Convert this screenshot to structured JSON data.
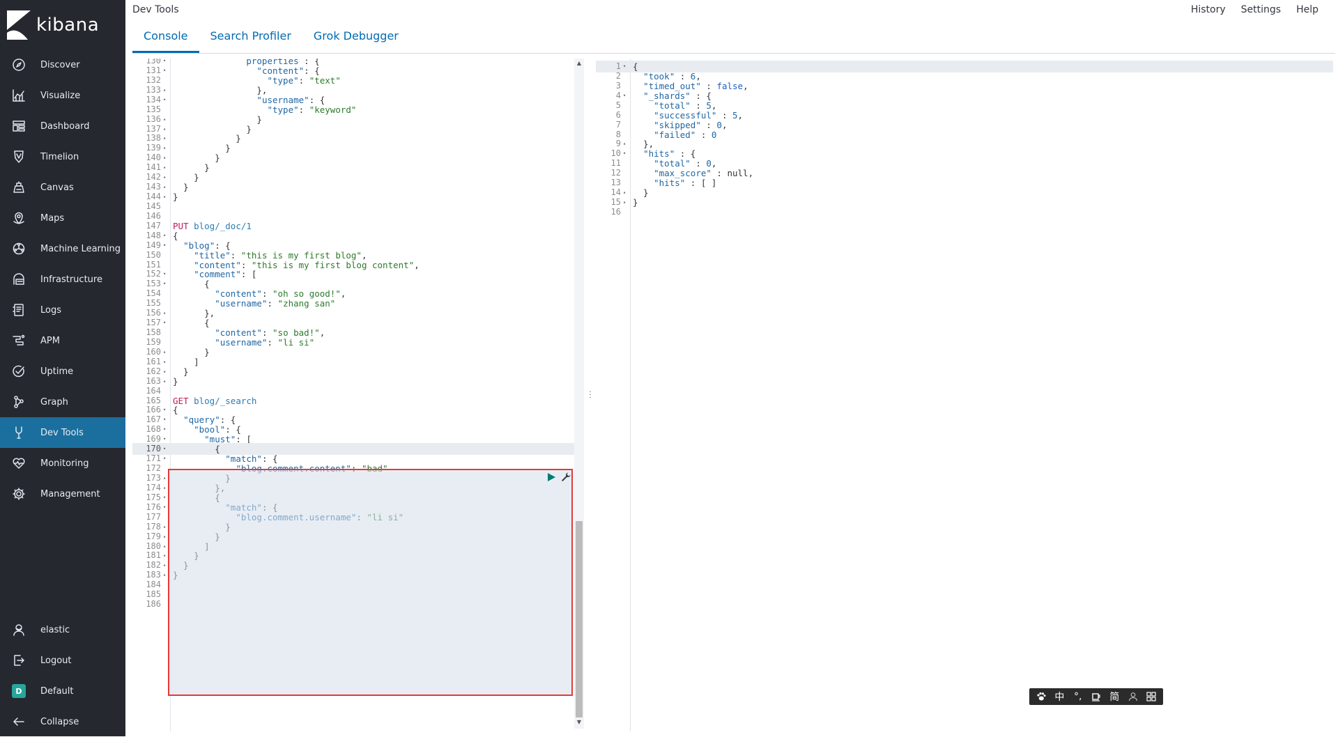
{
  "app": {
    "brand": "kibana",
    "title": "Dev Tools"
  },
  "header_links": [
    "History",
    "Settings",
    "Help"
  ],
  "tabs": [
    {
      "label": "Console",
      "active": true
    },
    {
      "label": "Search Profiler",
      "active": false
    },
    {
      "label": "Grok Debugger",
      "active": false
    }
  ],
  "sidebar": {
    "items": [
      {
        "label": "Discover",
        "icon": "compass-icon"
      },
      {
        "label": "Visualize",
        "icon": "visualize-icon"
      },
      {
        "label": "Dashboard",
        "icon": "dashboard-icon"
      },
      {
        "label": "Timelion",
        "icon": "timelion-icon"
      },
      {
        "label": "Canvas",
        "icon": "canvas-icon"
      },
      {
        "label": "Maps",
        "icon": "maps-icon"
      },
      {
        "label": "Machine Learning",
        "icon": "machine-learning-icon"
      },
      {
        "label": "Infrastructure",
        "icon": "infrastructure-icon"
      },
      {
        "label": "Logs",
        "icon": "logs-icon"
      },
      {
        "label": "APM",
        "icon": "apm-icon"
      },
      {
        "label": "Uptime",
        "icon": "uptime-icon"
      },
      {
        "label": "Graph",
        "icon": "graph-icon"
      },
      {
        "label": "Dev Tools",
        "icon": "dev-tools-icon",
        "active": true
      },
      {
        "label": "Monitoring",
        "icon": "monitoring-icon"
      },
      {
        "label": "Management",
        "icon": "gear-icon"
      }
    ],
    "bottom": [
      {
        "label": "elastic",
        "icon": "user-icon"
      },
      {
        "label": "Logout",
        "icon": "logout-icon"
      },
      {
        "label": "Default",
        "icon": "space-badge-icon",
        "badge": "D"
      },
      {
        "label": "Collapse",
        "icon": "arrow-left-icon"
      }
    ]
  },
  "colors": {
    "sidebar_bg": "#25282f",
    "active_bg": "#1b6f9e",
    "link_blue": "#006bb4",
    "selection_border": "#e53935"
  },
  "editor": {
    "current_line": "170",
    "lines": [
      {
        "n": "130",
        "fold": "▾",
        "t": [
          [
            "p",
            "              "
          ],
          [
            "k",
            "properties"
          ],
          [
            "p",
            " : {"
          ]
        ]
      },
      {
        "n": "131",
        "fold": "▾",
        "t": [
          [
            "p",
            "                "
          ],
          [
            "k",
            "\"content\""
          ],
          [
            "p",
            ": {"
          ]
        ]
      },
      {
        "n": "132",
        "fold": "",
        "t": [
          [
            "p",
            "                  "
          ],
          [
            "k",
            "\"type\""
          ],
          [
            "p",
            ": "
          ],
          [
            "s",
            "\"text\""
          ]
        ]
      },
      {
        "n": "133",
        "fold": "▴",
        "t": [
          [
            "p",
            "                },"
          ]
        ]
      },
      {
        "n": "134",
        "fold": "▾",
        "t": [
          [
            "p",
            "                "
          ],
          [
            "k",
            "\"username\""
          ],
          [
            "p",
            ": {"
          ]
        ]
      },
      {
        "n": "135",
        "fold": "",
        "t": [
          [
            "p",
            "                  "
          ],
          [
            "k",
            "\"type\""
          ],
          [
            "p",
            ": "
          ],
          [
            "s",
            "\"keyword\""
          ]
        ]
      },
      {
        "n": "136",
        "fold": "▴",
        "t": [
          [
            "p",
            "                }"
          ]
        ]
      },
      {
        "n": "137",
        "fold": "▴",
        "t": [
          [
            "p",
            "              }"
          ]
        ]
      },
      {
        "n": "138",
        "fold": "▴",
        "t": [
          [
            "p",
            "            }"
          ]
        ]
      },
      {
        "n": "139",
        "fold": "▴",
        "t": [
          [
            "p",
            "          }"
          ]
        ]
      },
      {
        "n": "140",
        "fold": "▴",
        "t": [
          [
            "p",
            "        }"
          ]
        ]
      },
      {
        "n": "141",
        "fold": "▴",
        "t": [
          [
            "p",
            "      }"
          ]
        ]
      },
      {
        "n": "142",
        "fold": "▴",
        "t": [
          [
            "p",
            "    }"
          ]
        ]
      },
      {
        "n": "143",
        "fold": "▴",
        "t": [
          [
            "p",
            "  }"
          ]
        ]
      },
      {
        "n": "144",
        "fold": "▴",
        "t": [
          [
            "p",
            "}"
          ]
        ]
      },
      {
        "n": "145",
        "fold": "",
        "t": []
      },
      {
        "n": "146",
        "fold": "",
        "t": []
      },
      {
        "n": "147",
        "fold": "",
        "t": [
          [
            "m",
            "PUT"
          ],
          [
            "p",
            " "
          ],
          [
            "u",
            "blog/_doc/1"
          ]
        ]
      },
      {
        "n": "148",
        "fold": "▾",
        "t": [
          [
            "p",
            "{"
          ]
        ]
      },
      {
        "n": "149",
        "fold": "▾",
        "t": [
          [
            "p",
            "  "
          ],
          [
            "k",
            "\"blog\""
          ],
          [
            "p",
            ": {"
          ]
        ]
      },
      {
        "n": "150",
        "fold": "",
        "t": [
          [
            "p",
            "    "
          ],
          [
            "k",
            "\"title\""
          ],
          [
            "p",
            ": "
          ],
          [
            "s",
            "\"this is my first blog\""
          ],
          [
            "p",
            ","
          ]
        ]
      },
      {
        "n": "151",
        "fold": "",
        "t": [
          [
            "p",
            "    "
          ],
          [
            "k",
            "\"content\""
          ],
          [
            "p",
            ": "
          ],
          [
            "s",
            "\"this is my first blog content\""
          ],
          [
            "p",
            ","
          ]
        ]
      },
      {
        "n": "152",
        "fold": "▾",
        "t": [
          [
            "p",
            "    "
          ],
          [
            "k",
            "\"comment\""
          ],
          [
            "p",
            ": ["
          ]
        ]
      },
      {
        "n": "153",
        "fold": "▾",
        "t": [
          [
            "p",
            "      {"
          ]
        ]
      },
      {
        "n": "154",
        "fold": "",
        "t": [
          [
            "p",
            "        "
          ],
          [
            "k",
            "\"content\""
          ],
          [
            "p",
            ": "
          ],
          [
            "s",
            "\"oh so good!\""
          ],
          [
            "p",
            ","
          ]
        ]
      },
      {
        "n": "155",
        "fold": "",
        "t": [
          [
            "p",
            "        "
          ],
          [
            "k",
            "\"username\""
          ],
          [
            "p",
            ": "
          ],
          [
            "s",
            "\"zhang san\""
          ]
        ]
      },
      {
        "n": "156",
        "fold": "▴",
        "t": [
          [
            "p",
            "      },"
          ]
        ]
      },
      {
        "n": "157",
        "fold": "▾",
        "t": [
          [
            "p",
            "      {"
          ]
        ]
      },
      {
        "n": "158",
        "fold": "",
        "t": [
          [
            "p",
            "        "
          ],
          [
            "k",
            "\"content\""
          ],
          [
            "p",
            ": "
          ],
          [
            "s",
            "\"so bad!\""
          ],
          [
            "p",
            ","
          ]
        ]
      },
      {
        "n": "159",
        "fold": "",
        "t": [
          [
            "p",
            "        "
          ],
          [
            "k",
            "\"username\""
          ],
          [
            "p",
            ": "
          ],
          [
            "s",
            "\"li si\""
          ]
        ]
      },
      {
        "n": "160",
        "fold": "▴",
        "t": [
          [
            "p",
            "      }"
          ]
        ]
      },
      {
        "n": "161",
        "fold": "▴",
        "t": [
          [
            "p",
            "    ]"
          ]
        ]
      },
      {
        "n": "162",
        "fold": "▴",
        "t": [
          [
            "p",
            "  }"
          ]
        ]
      },
      {
        "n": "163",
        "fold": "▴",
        "t": [
          [
            "p",
            "}"
          ]
        ]
      },
      {
        "n": "164",
        "fold": "",
        "t": []
      },
      {
        "n": "165",
        "fold": "",
        "t": [
          [
            "m",
            "GET"
          ],
          [
            "p",
            " "
          ],
          [
            "u",
            "blog/_search"
          ]
        ]
      },
      {
        "n": "166",
        "fold": "▾",
        "t": [
          [
            "p",
            "{"
          ]
        ]
      },
      {
        "n": "167",
        "fold": "▾",
        "t": [
          [
            "p",
            "  "
          ],
          [
            "k",
            "\"query\""
          ],
          [
            "p",
            ": {"
          ]
        ]
      },
      {
        "n": "168",
        "fold": "▾",
        "t": [
          [
            "p",
            "    "
          ],
          [
            "k",
            "\"bool\""
          ],
          [
            "p",
            ": {"
          ]
        ]
      },
      {
        "n": "169",
        "fold": "▾",
        "t": [
          [
            "p",
            "      "
          ],
          [
            "k",
            "\"must\""
          ],
          [
            "p",
            ": ["
          ]
        ]
      },
      {
        "n": "170",
        "fold": "▾",
        "t": [
          [
            "p",
            "        {"
          ]
        ]
      },
      {
        "n": "171",
        "fold": "▾",
        "t": [
          [
            "p",
            "          "
          ],
          [
            "k",
            "\"match\""
          ],
          [
            "p",
            ": {"
          ]
        ]
      },
      {
        "n": "172",
        "fold": "",
        "t": [
          [
            "p",
            "            "
          ],
          [
            "k",
            "\"blog.comment.content\""
          ],
          [
            "p",
            ": "
          ],
          [
            "s",
            "\"bad\""
          ]
        ]
      },
      {
        "n": "173",
        "fold": "▴",
        "t": [
          [
            "p",
            "          }"
          ]
        ]
      },
      {
        "n": "174",
        "fold": "▴",
        "t": [
          [
            "p",
            "        },"
          ]
        ]
      },
      {
        "n": "175",
        "fold": "▾",
        "t": [
          [
            "p",
            "        {"
          ]
        ]
      },
      {
        "n": "176",
        "fold": "▾",
        "t": [
          [
            "p",
            "          "
          ],
          [
            "k",
            "\"match\""
          ],
          [
            "p",
            ": {"
          ]
        ]
      },
      {
        "n": "177",
        "fold": "",
        "t": [
          [
            "p",
            "            "
          ],
          [
            "k",
            "\"blog.comment.username\""
          ],
          [
            "p",
            ": "
          ],
          [
            "s",
            "\"li si\""
          ]
        ]
      },
      {
        "n": "178",
        "fold": "▴",
        "t": [
          [
            "p",
            "          }"
          ]
        ]
      },
      {
        "n": "179",
        "fold": "▴",
        "t": [
          [
            "p",
            "        }"
          ]
        ]
      },
      {
        "n": "180",
        "fold": "▴",
        "t": [
          [
            "p",
            "      ]"
          ]
        ]
      },
      {
        "n": "181",
        "fold": "▴",
        "t": [
          [
            "p",
            "    }"
          ]
        ]
      },
      {
        "n": "182",
        "fold": "▴",
        "t": [
          [
            "p",
            "  }"
          ]
        ]
      },
      {
        "n": "183",
        "fold": "▴",
        "t": [
          [
            "p",
            "}"
          ]
        ]
      },
      {
        "n": "184",
        "fold": "",
        "t": []
      },
      {
        "n": "185",
        "fold": "",
        "t": []
      },
      {
        "n": "186",
        "fold": "",
        "t": []
      }
    ]
  },
  "output": {
    "lines": [
      {
        "n": "1",
        "fold": "▾",
        "t": [
          [
            "p",
            "{"
          ]
        ]
      },
      {
        "n": "2",
        "fold": "",
        "t": [
          [
            "p",
            "  "
          ],
          [
            "k",
            "\"took\""
          ],
          [
            "p",
            " : "
          ],
          [
            "num",
            "6"
          ],
          [
            "p",
            ","
          ]
        ]
      },
      {
        "n": "3",
        "fold": "",
        "t": [
          [
            "p",
            "  "
          ],
          [
            "k",
            "\"timed_out\""
          ],
          [
            "p",
            " : "
          ],
          [
            "kw",
            "false"
          ],
          [
            "p",
            ","
          ]
        ]
      },
      {
        "n": "4",
        "fold": "▾",
        "t": [
          [
            "p",
            "  "
          ],
          [
            "k",
            "\"_shards\""
          ],
          [
            "p",
            " : {"
          ]
        ]
      },
      {
        "n": "5",
        "fold": "",
        "t": [
          [
            "p",
            "    "
          ],
          [
            "k",
            "\"total\""
          ],
          [
            "p",
            " : "
          ],
          [
            "num",
            "5"
          ],
          [
            "p",
            ","
          ]
        ]
      },
      {
        "n": "6",
        "fold": "",
        "t": [
          [
            "p",
            "    "
          ],
          [
            "k",
            "\"successful\""
          ],
          [
            "p",
            " : "
          ],
          [
            "num",
            "5"
          ],
          [
            "p",
            ","
          ]
        ]
      },
      {
        "n": "7",
        "fold": "",
        "t": [
          [
            "p",
            "    "
          ],
          [
            "k",
            "\"skipped\""
          ],
          [
            "p",
            " : "
          ],
          [
            "num",
            "0"
          ],
          [
            "p",
            ","
          ]
        ]
      },
      {
        "n": "8",
        "fold": "",
        "t": [
          [
            "p",
            "    "
          ],
          [
            "k",
            "\"failed\""
          ],
          [
            "p",
            " : "
          ],
          [
            "num",
            "0"
          ]
        ]
      },
      {
        "n": "9",
        "fold": "▴",
        "t": [
          [
            "p",
            "  },"
          ]
        ]
      },
      {
        "n": "10",
        "fold": "▾",
        "t": [
          [
            "p",
            "  "
          ],
          [
            "k",
            "\"hits\""
          ],
          [
            "p",
            " : {"
          ]
        ]
      },
      {
        "n": "11",
        "fold": "",
        "t": [
          [
            "p",
            "    "
          ],
          [
            "k",
            "\"total\""
          ],
          [
            "p",
            " : "
          ],
          [
            "num",
            "0"
          ],
          [
            "p",
            ","
          ]
        ]
      },
      {
        "n": "12",
        "fold": "",
        "t": [
          [
            "p",
            "    "
          ],
          [
            "k",
            "\"max_score\""
          ],
          [
            "p",
            " : "
          ],
          [
            "p",
            "null"
          ],
          [
            "p",
            ","
          ]
        ]
      },
      {
        "n": "13",
        "fold": "",
        "t": [
          [
            "p",
            "    "
          ],
          [
            "k",
            "\"hits\""
          ],
          [
            "p",
            " : [ ]"
          ]
        ]
      },
      {
        "n": "14",
        "fold": "▴",
        "t": [
          [
            "p",
            "  }"
          ]
        ]
      },
      {
        "n": "15",
        "fold": "▴",
        "t": [
          [
            "p",
            "}"
          ]
        ]
      },
      {
        "n": "16",
        "fold": "",
        "t": []
      }
    ]
  },
  "ime_toolbar": [
    "paw-icon",
    "中",
    "°,",
    "cup-icon",
    "简",
    "user-icon",
    "grid-icon"
  ]
}
